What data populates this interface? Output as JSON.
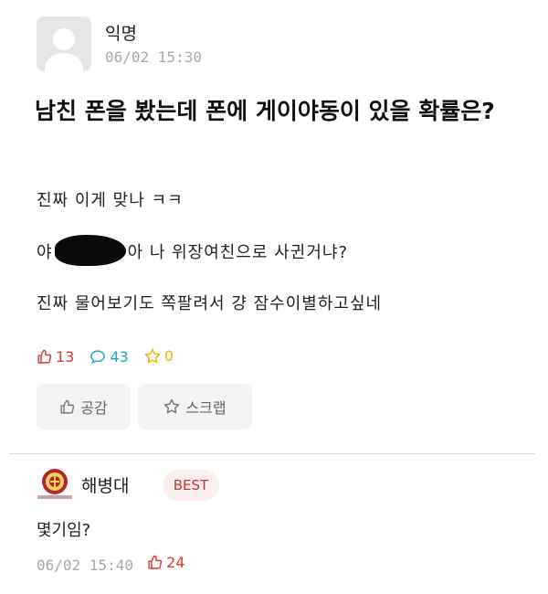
{
  "post": {
    "author": "익명",
    "date": "06/02 15:30",
    "title": "남친 폰을 봤는데 폰에 게이야동이 있을 확률은?",
    "body_line1": "진짜 이게 맞나 ㅋㅋ",
    "body_line2_before": "야",
    "body_line2_after": "아 나 위장여친으로 사귄거냐?",
    "body_line3": "진짜 물어보기도 쪽팔려서 걍 잠수이별하고싶네",
    "likes": "13",
    "comments": "43",
    "scraps": "0",
    "like_button_label": "공감",
    "scrap_button_label": "스크랩"
  },
  "comment": {
    "author": "해병대",
    "badge": "BEST",
    "text": "몇기임?",
    "date": "06/02 15:40",
    "likes": "24"
  },
  "colors": {
    "like": "#e0362c",
    "comment": "#1ea7c5",
    "scrap": "#f0b000",
    "best_bg": "#fbeeee"
  },
  "icons": {
    "like": "thumbs-up-icon",
    "comment": "speech-bubble-icon",
    "scrap": "star-icon"
  }
}
